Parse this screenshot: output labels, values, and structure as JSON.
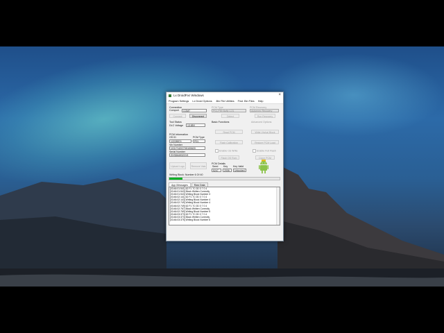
{
  "window": {
    "title": "Lx DroidFixr Windows"
  },
  "menu": [
    "Program Settings",
    "Lx Droid Options",
    ".Bin File Utilities",
    "Find .Bin Files",
    "Help"
  ],
  "connection": {
    "heading": "Connection",
    "port_label": "Comport",
    "port_value": "COM7",
    "connect_label": "Connect",
    "disconnect_label": "Disconnect"
  },
  "tool_status": {
    "heading": "Tool Status",
    "dlc_label": "DLC Voltage",
    "dlc_value": "13.85V"
  },
  "pcm_info": {
    "heading": "PCM Information",
    "os_label": "OS ID",
    "os_value": "12228574",
    "type_label": "PCM Type",
    "type_value": "P01",
    "vin_label": "Vin Number",
    "vin_value": "1G1YY42G7X5100620",
    "serial_label": "Serial Number",
    "serial_value": "ZXSD6493221S",
    "upload_label": "Upload Logs",
    "remove_label": "Remove Vats"
  },
  "pcm_type": {
    "heading": "PCM Type",
    "value": "P01-P59 Buffy 1.21",
    "detect_label": "Detect"
  },
  "pcm_recovery": {
    "heading": "PCM Recovery",
    "value": "Autoexec Recovery",
    "button_label": "Run Recovery"
  },
  "basic_functions": {
    "heading": "Basic Functions",
    "read_label": "Read PCM",
    "flash_label": "Flash Calibration",
    "enable_label": "Enable CE Write",
    "flash_os_label": "Flash OS Rom"
  },
  "advanced": {
    "heading": "Advanced Options",
    "write_label": "Write Vin/cal Block",
    "restore_label": "Restore PCM Load",
    "enable_full_label": "Enable Full Flash",
    "clone_label": "Clone PCM"
  },
  "pcm_details": {
    "heading": "PCM Details",
    "seed_label": "Seed",
    "key_label": "Key",
    "keyvalid_label": "Key Valid",
    "seed_value": "5247",
    "key_value": "2006",
    "keyvalid_value": "Unlocked"
  },
  "progress": {
    "label": "Writing Block: Number 6 Of 40",
    "fraction": 0.12
  },
  "tabs": [
    "App Messages",
    "Raw Data"
  ],
  "log": [
    "[03:46:01:541] 62 F1 7C 0D 0 7 0 4",
    "[03:46:01:543] Block Written Correctly",
    "[03:46:01:543] Writing Block Number 3",
    "[03:46:02:141] 62 F1 7C 0D 0 7 0 4",
    "[03:46:02:143] Writing Block Number 4",
    "[03:46:02:749] Writing Block Number 4",
    "[03:46:02:749] 62 F1 7C 0D 0 7 0 4",
    "[03:46:02:767] Block Written Correctly",
    "[03:46:02:769] Writing Block Number 5",
    "[03:46:03:373] 62 F1 7C 0D 0 7 0 4",
    "[03:46:03:373] Block Written Correctly",
    "[03:46:03:375] Writing Block Number 6"
  ]
}
